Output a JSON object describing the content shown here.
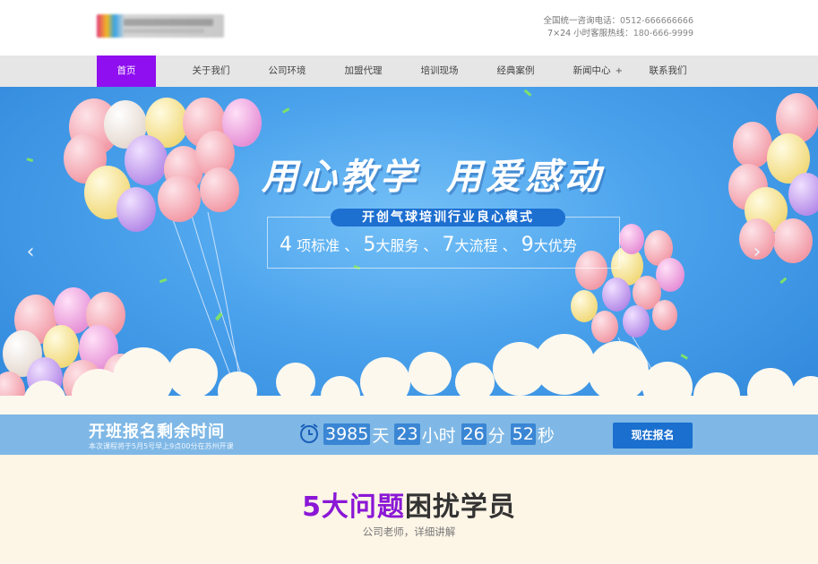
{
  "header": {
    "contact_line1_label": "全国统一咨询电话：",
    "contact_line1_value": "0512-666666666",
    "contact_line2_label": "7×24 小时客服热线：",
    "contact_line2_value": "180-666-9999"
  },
  "nav": {
    "items": [
      {
        "label": "首页"
      },
      {
        "label": "关于我们"
      },
      {
        "label": "公司环境"
      },
      {
        "label": "加盟代理"
      },
      {
        "label": "培训现场"
      },
      {
        "label": "经典案例"
      },
      {
        "label": "新闻中心",
        "plus": "+"
      },
      {
        "label": "联系我们"
      }
    ]
  },
  "banner": {
    "headline_part1": "用心教学",
    "headline_part2": "用爱感动",
    "subtitle": "开创气球培训行业良心模式",
    "features": [
      {
        "num": "4",
        "text": "项标准"
      },
      {
        "num": "5",
        "text": "大服务"
      },
      {
        "num": "7",
        "text": "大流程"
      },
      {
        "num": "9",
        "text": "大优势"
      }
    ],
    "separator": "、",
    "prev_arrow": "‹",
    "next_arrow": "›"
  },
  "countdown": {
    "title": "开班报名剩余时间",
    "subtitle": "本次课程将于5月5号早上9点00分在苏州开课",
    "days": "3985",
    "days_unit": "天",
    "hours": "23",
    "hours_unit": "小时",
    "minutes": "26",
    "minutes_unit": "分",
    "seconds": "52",
    "seconds_unit": "秒",
    "button": "现在报名"
  },
  "section": {
    "title_highlight": "5大问题",
    "title_rest": "困扰学员",
    "subtitle": "公司老师，详细讲解"
  },
  "colors": {
    "accent_purple": "#8f0ff0",
    "banner_blue": "#4aa2ec",
    "button_blue": "#1a6fcf",
    "section_bg": "#fdf5e6"
  }
}
